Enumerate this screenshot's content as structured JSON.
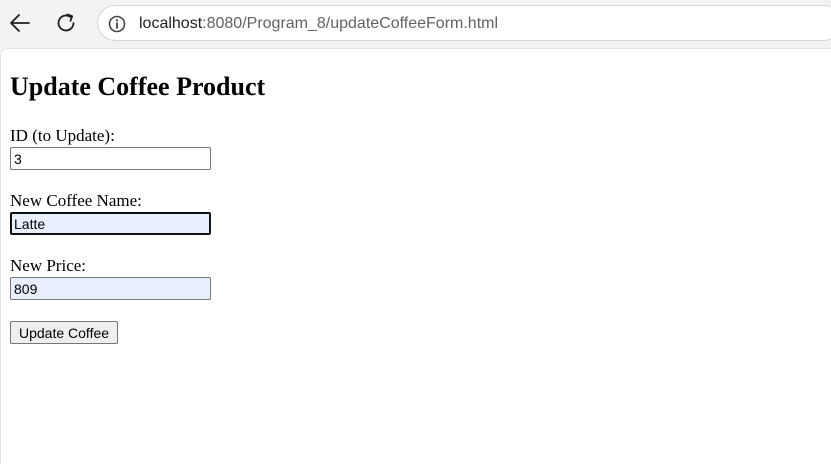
{
  "browser": {
    "url_host": "localhost",
    "url_path": ":8080/Program_8/updateCoffeeForm.html",
    "icons": {
      "back": "back-arrow-icon",
      "reload": "reload-icon",
      "site_info": "info-icon"
    }
  },
  "page": {
    "title": "Update Coffee Product",
    "form": {
      "id_label": "ID (to Update):",
      "id_value": "3",
      "name_label": "New Coffee Name:",
      "name_value": "Latte",
      "price_label": "New Price:",
      "price_value": "809",
      "submit_label": "Update Coffee"
    }
  },
  "colors": {
    "autofill_background": "#e8f0fe",
    "browser_chrome": "#f3f3f3"
  }
}
